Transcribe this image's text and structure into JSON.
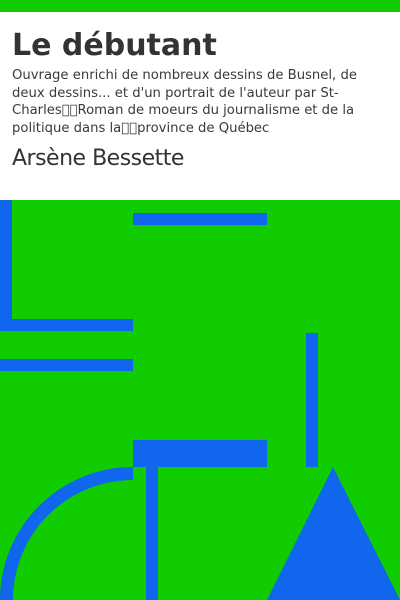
{
  "book": {
    "title": "Le débutant",
    "subtitle": "Ouvrage enrichi de nombreux dessins de Busnel, de deux dessins... et d'un portrait de l'auteur par St-Charles\u0000\u0000Roman de moeurs du journalisme et de la politique dans la\u0000\u0000province de Québec",
    "author": "Arsène Bessette"
  },
  "colors": {
    "background": "#11cc00",
    "shapes": "#1166ee",
    "text": "#333333"
  }
}
